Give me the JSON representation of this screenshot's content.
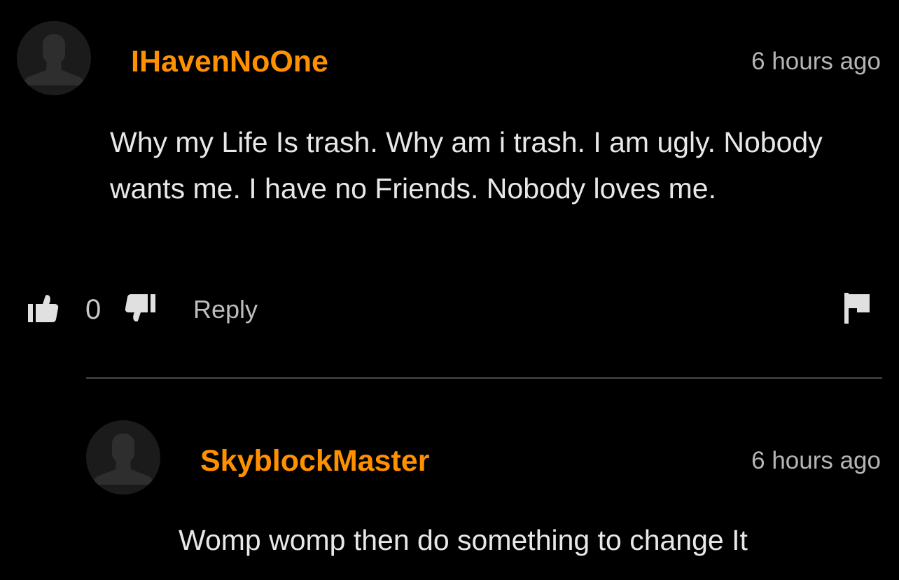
{
  "comment": {
    "username": "IHavenNoOne",
    "timestamp": "6 hours ago",
    "text": "Why my Life Is trash. Why am i trash. I am ugly. Nobody wants me. I have no Friends. Nobody loves me.",
    "vote_count": "0",
    "reply_label": "Reply"
  },
  "reply": {
    "username": "SkyblockMaster",
    "timestamp": "6 hours ago",
    "text": "Womp womp then do something to change It"
  },
  "icons": {
    "avatar": "user-silhouette-icon",
    "upvote": "thumbs-up-icon",
    "downvote": "thumbs-down-icon",
    "flag": "flag-icon"
  },
  "colors": {
    "background": "#000000",
    "username": "#ff9000",
    "text": "#e8e8e8",
    "muted": "#b5b5b5"
  }
}
